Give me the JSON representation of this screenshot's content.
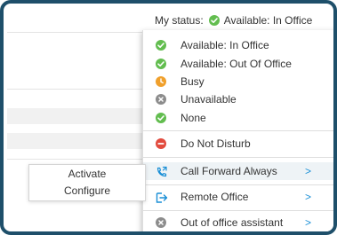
{
  "header": {
    "status_label": "My status:",
    "status_value": "Available: In Office"
  },
  "menu": {
    "items": [
      {
        "label": "Available: In Office",
        "icon": "check-circle-icon",
        "color": "#62bd4f"
      },
      {
        "label": "Available: Out Of Office",
        "icon": "check-circle-icon",
        "color": "#62bd4f"
      },
      {
        "label": "Busy",
        "icon": "clock-icon",
        "color": "#f0a02c"
      },
      {
        "label": "Unavailable",
        "icon": "x-circle-icon",
        "color": "#8c8c8c"
      },
      {
        "label": "None",
        "icon": "check-circle-icon",
        "color": "#62bd4f"
      },
      {
        "label": "Do Not Disturb",
        "icon": "minus-circle-icon",
        "color": "#e24b3e"
      },
      {
        "label": "Call Forward Always",
        "icon": "call-forward-icon",
        "color": "#1a8fd6"
      },
      {
        "label": "Remote Office",
        "icon": "remote-office-icon",
        "color": "#1a8fd6"
      },
      {
        "label": "Out of office assistant",
        "icon": "x-circle-icon",
        "color": "#8c8c8c"
      }
    ]
  },
  "submenu": {
    "items": [
      {
        "label": "Activate"
      },
      {
        "label": "Configure"
      }
    ]
  },
  "colors": {
    "frame": "#1e4f6a",
    "accent": "#1a8fd6"
  }
}
